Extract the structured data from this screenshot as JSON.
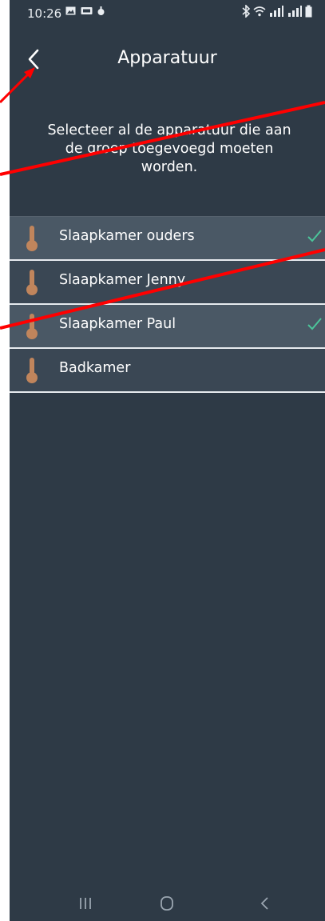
{
  "status": {
    "time": "10:26",
    "left_icons": [
      "gallery-icon",
      "vpn-icon",
      "notification-icon"
    ],
    "right_icons": [
      "bluetooth-icon",
      "wifi-icon",
      "signal-icon",
      "signal-icon",
      "battery-icon"
    ]
  },
  "header": {
    "title": "Apparatuur",
    "back_icon": "chevron-left-icon"
  },
  "intro": {
    "text": "Selecteer al de apparatuur die aan de groep toegevoegd moeten worden."
  },
  "devices": [
    {
      "label": "Slaapkamer ouders",
      "selected": true,
      "icon": "thermometer-icon"
    },
    {
      "label": "Slaapkamer Jenny",
      "selected": false,
      "icon": "thermometer-icon"
    },
    {
      "label": "Slaapkamer Paul",
      "selected": true,
      "icon": "thermometer-icon"
    },
    {
      "label": "Badkamer",
      "selected": false,
      "icon": "thermometer-icon"
    }
  ],
  "navbar": {
    "items": [
      "recent-apps-icon",
      "home-icon",
      "back-icon"
    ]
  },
  "colors": {
    "background": "#2e3a46",
    "selected_row": "#4a5865",
    "unselected_row": "#3a4754",
    "check": "#4bc59a",
    "thermometer": "#c0855c",
    "annotation_arrow": "#ff0000"
  }
}
